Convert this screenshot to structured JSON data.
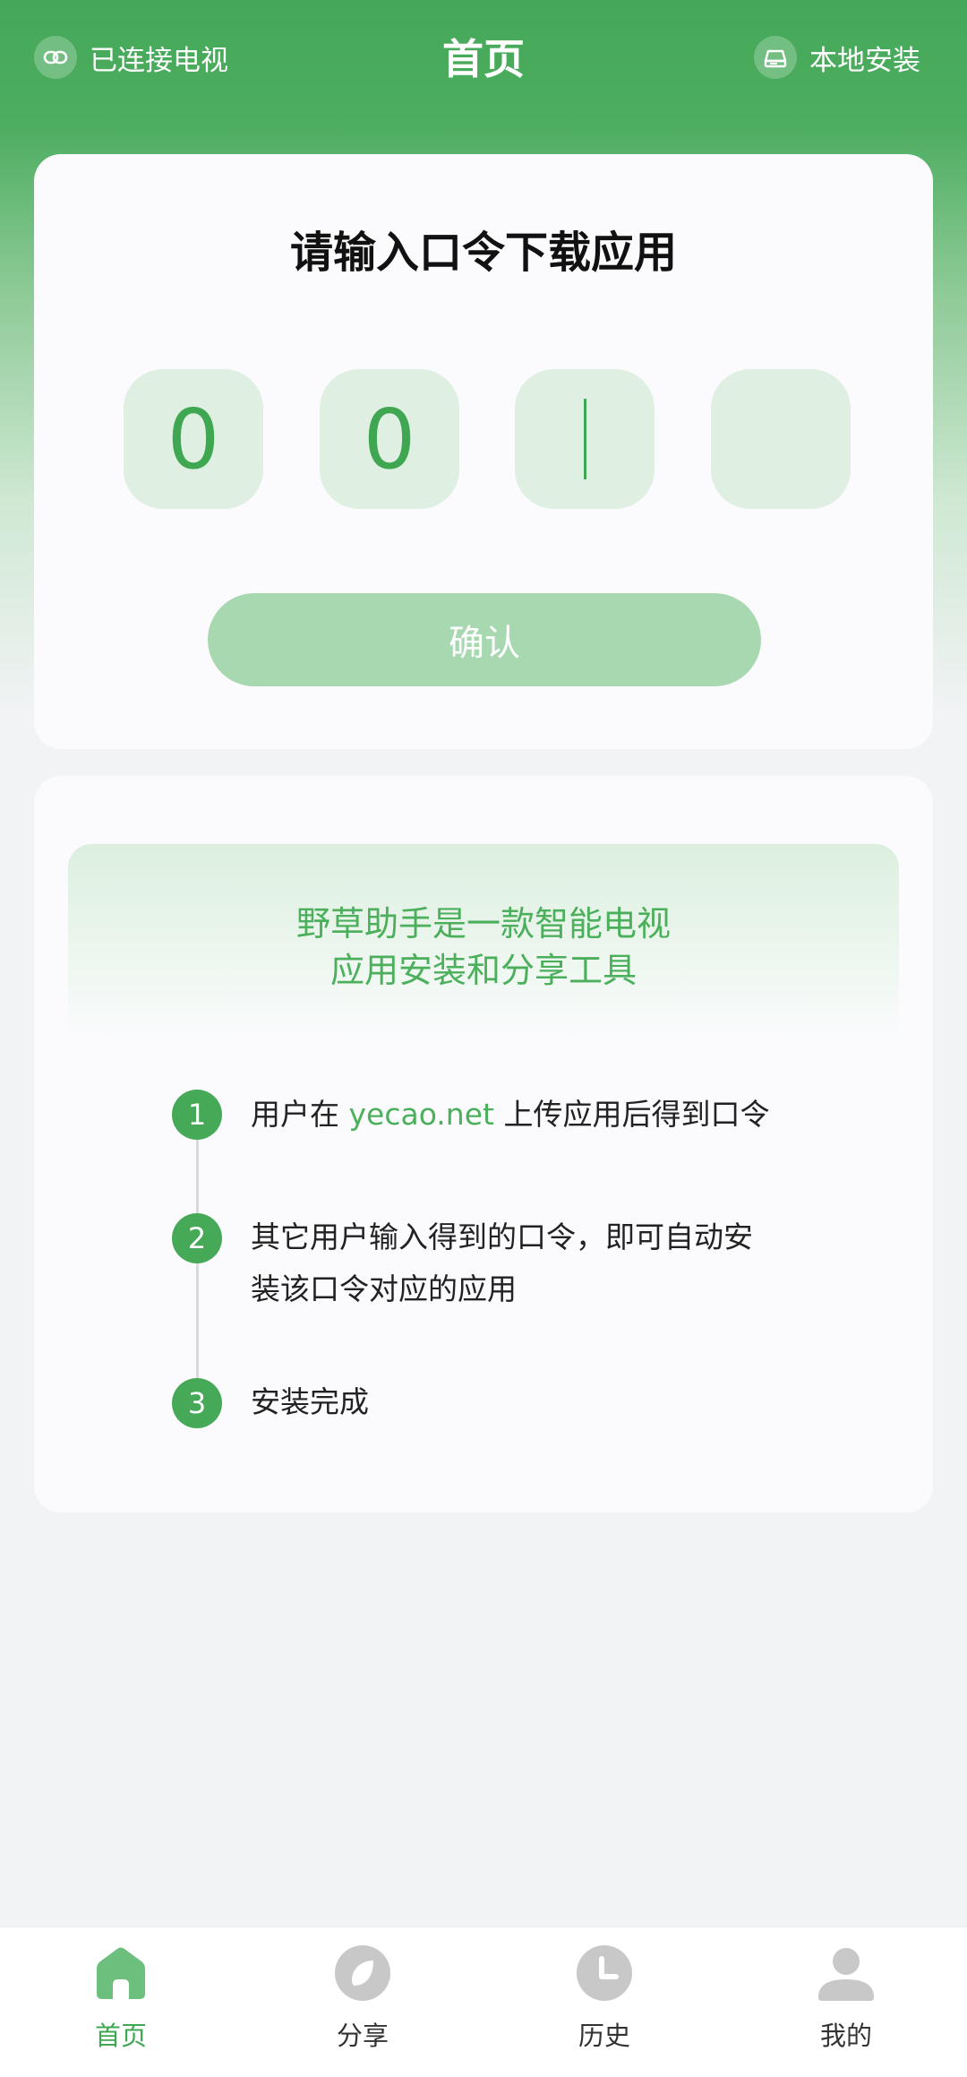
{
  "header": {
    "title": "首页",
    "left_label": "已连接电视",
    "right_label": "本地安装"
  },
  "code_card": {
    "title": "请输入口令下载应用",
    "digits": [
      "0",
      "0",
      "",
      ""
    ],
    "confirm_label": "确认"
  },
  "info_card": {
    "intro_line1": "野草助手是一款智能电视",
    "intro_line2": "应用安装和分享工具",
    "steps": [
      {
        "num": "1",
        "prefix": "用户在 ",
        "link": "yecao.net",
        "suffix": " 上传应用后得到口令"
      },
      {
        "num": "2",
        "line1": "其它用户输入得到的口令，即可自动安",
        "line2": "装该口令对应的应用"
      },
      {
        "num": "3",
        "text": "安装完成"
      }
    ]
  },
  "nav": {
    "items": [
      {
        "label": "首页",
        "icon": "home-icon",
        "active": true
      },
      {
        "label": "分享",
        "icon": "compass-leaf-icon",
        "active": false
      },
      {
        "label": "历史",
        "icon": "clock-icon",
        "active": false
      },
      {
        "label": "我的",
        "icon": "user-icon",
        "active": false
      }
    ]
  },
  "colors": {
    "accent": "#3fa752",
    "accent_light": "#a8d8b0",
    "code_box_bg": "#dfefe2",
    "inactive_icon": "#c8c8c8"
  }
}
